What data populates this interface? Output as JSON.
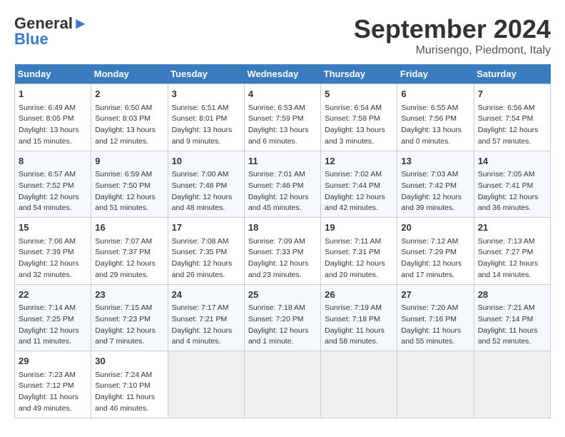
{
  "header": {
    "logo_line1": "General",
    "logo_line2": "Blue",
    "month": "September 2024",
    "location": "Murisengo, Piedmont, Italy"
  },
  "weekdays": [
    "Sunday",
    "Monday",
    "Tuesday",
    "Wednesday",
    "Thursday",
    "Friday",
    "Saturday"
  ],
  "weeks": [
    [
      {
        "day": "1",
        "lines": [
          "Sunrise: 6:49 AM",
          "Sunset: 8:05 PM",
          "Daylight: 13 hours",
          "and 15 minutes."
        ]
      },
      {
        "day": "2",
        "lines": [
          "Sunrise: 6:50 AM",
          "Sunset: 8:03 PM",
          "Daylight: 13 hours",
          "and 12 minutes."
        ]
      },
      {
        "day": "3",
        "lines": [
          "Sunrise: 6:51 AM",
          "Sunset: 8:01 PM",
          "Daylight: 13 hours",
          "and 9 minutes."
        ]
      },
      {
        "day": "4",
        "lines": [
          "Sunrise: 6:53 AM",
          "Sunset: 7:59 PM",
          "Daylight: 13 hours",
          "and 6 minutes."
        ]
      },
      {
        "day": "5",
        "lines": [
          "Sunrise: 6:54 AM",
          "Sunset: 7:58 PM",
          "Daylight: 13 hours",
          "and 3 minutes."
        ]
      },
      {
        "day": "6",
        "lines": [
          "Sunrise: 6:55 AM",
          "Sunset: 7:56 PM",
          "Daylight: 13 hours",
          "and 0 minutes."
        ]
      },
      {
        "day": "7",
        "lines": [
          "Sunrise: 6:56 AM",
          "Sunset: 7:54 PM",
          "Daylight: 12 hours",
          "and 57 minutes."
        ]
      }
    ],
    [
      {
        "day": "8",
        "lines": [
          "Sunrise: 6:57 AM",
          "Sunset: 7:52 PM",
          "Daylight: 12 hours",
          "and 54 minutes."
        ]
      },
      {
        "day": "9",
        "lines": [
          "Sunrise: 6:59 AM",
          "Sunset: 7:50 PM",
          "Daylight: 12 hours",
          "and 51 minutes."
        ]
      },
      {
        "day": "10",
        "lines": [
          "Sunrise: 7:00 AM",
          "Sunset: 7:48 PM",
          "Daylight: 12 hours",
          "and 48 minutes."
        ]
      },
      {
        "day": "11",
        "lines": [
          "Sunrise: 7:01 AM",
          "Sunset: 7:46 PM",
          "Daylight: 12 hours",
          "and 45 minutes."
        ]
      },
      {
        "day": "12",
        "lines": [
          "Sunrise: 7:02 AM",
          "Sunset: 7:44 PM",
          "Daylight: 12 hours",
          "and 42 minutes."
        ]
      },
      {
        "day": "13",
        "lines": [
          "Sunrise: 7:03 AM",
          "Sunset: 7:42 PM",
          "Daylight: 12 hours",
          "and 39 minutes."
        ]
      },
      {
        "day": "14",
        "lines": [
          "Sunrise: 7:05 AM",
          "Sunset: 7:41 PM",
          "Daylight: 12 hours",
          "and 36 minutes."
        ]
      }
    ],
    [
      {
        "day": "15",
        "lines": [
          "Sunrise: 7:06 AM",
          "Sunset: 7:39 PM",
          "Daylight: 12 hours",
          "and 32 minutes."
        ]
      },
      {
        "day": "16",
        "lines": [
          "Sunrise: 7:07 AM",
          "Sunset: 7:37 PM",
          "Daylight: 12 hours",
          "and 29 minutes."
        ]
      },
      {
        "day": "17",
        "lines": [
          "Sunrise: 7:08 AM",
          "Sunset: 7:35 PM",
          "Daylight: 12 hours",
          "and 26 minutes."
        ]
      },
      {
        "day": "18",
        "lines": [
          "Sunrise: 7:09 AM",
          "Sunset: 7:33 PM",
          "Daylight: 12 hours",
          "and 23 minutes."
        ]
      },
      {
        "day": "19",
        "lines": [
          "Sunrise: 7:11 AM",
          "Sunset: 7:31 PM",
          "Daylight: 12 hours",
          "and 20 minutes."
        ]
      },
      {
        "day": "20",
        "lines": [
          "Sunrise: 7:12 AM",
          "Sunset: 7:29 PM",
          "Daylight: 12 hours",
          "and 17 minutes."
        ]
      },
      {
        "day": "21",
        "lines": [
          "Sunrise: 7:13 AM",
          "Sunset: 7:27 PM",
          "Daylight: 12 hours",
          "and 14 minutes."
        ]
      }
    ],
    [
      {
        "day": "22",
        "lines": [
          "Sunrise: 7:14 AM",
          "Sunset: 7:25 PM",
          "Daylight: 12 hours",
          "and 11 minutes."
        ]
      },
      {
        "day": "23",
        "lines": [
          "Sunrise: 7:15 AM",
          "Sunset: 7:23 PM",
          "Daylight: 12 hours",
          "and 7 minutes."
        ]
      },
      {
        "day": "24",
        "lines": [
          "Sunrise: 7:17 AM",
          "Sunset: 7:21 PM",
          "Daylight: 12 hours",
          "and 4 minutes."
        ]
      },
      {
        "day": "25",
        "lines": [
          "Sunrise: 7:18 AM",
          "Sunset: 7:20 PM",
          "Daylight: 12 hours",
          "and 1 minute."
        ]
      },
      {
        "day": "26",
        "lines": [
          "Sunrise: 7:19 AM",
          "Sunset: 7:18 PM",
          "Daylight: 11 hours",
          "and 58 minutes."
        ]
      },
      {
        "day": "27",
        "lines": [
          "Sunrise: 7:20 AM",
          "Sunset: 7:16 PM",
          "Daylight: 11 hours",
          "and 55 minutes."
        ]
      },
      {
        "day": "28",
        "lines": [
          "Sunrise: 7:21 AM",
          "Sunset: 7:14 PM",
          "Daylight: 11 hours",
          "and 52 minutes."
        ]
      }
    ],
    [
      {
        "day": "29",
        "lines": [
          "Sunrise: 7:23 AM",
          "Sunset: 7:12 PM",
          "Daylight: 11 hours",
          "and 49 minutes."
        ]
      },
      {
        "day": "30",
        "lines": [
          "Sunrise: 7:24 AM",
          "Sunset: 7:10 PM",
          "Daylight: 11 hours",
          "and 46 minutes."
        ]
      },
      {
        "day": "",
        "lines": []
      },
      {
        "day": "",
        "lines": []
      },
      {
        "day": "",
        "lines": []
      },
      {
        "day": "",
        "lines": []
      },
      {
        "day": "",
        "lines": []
      }
    ]
  ]
}
